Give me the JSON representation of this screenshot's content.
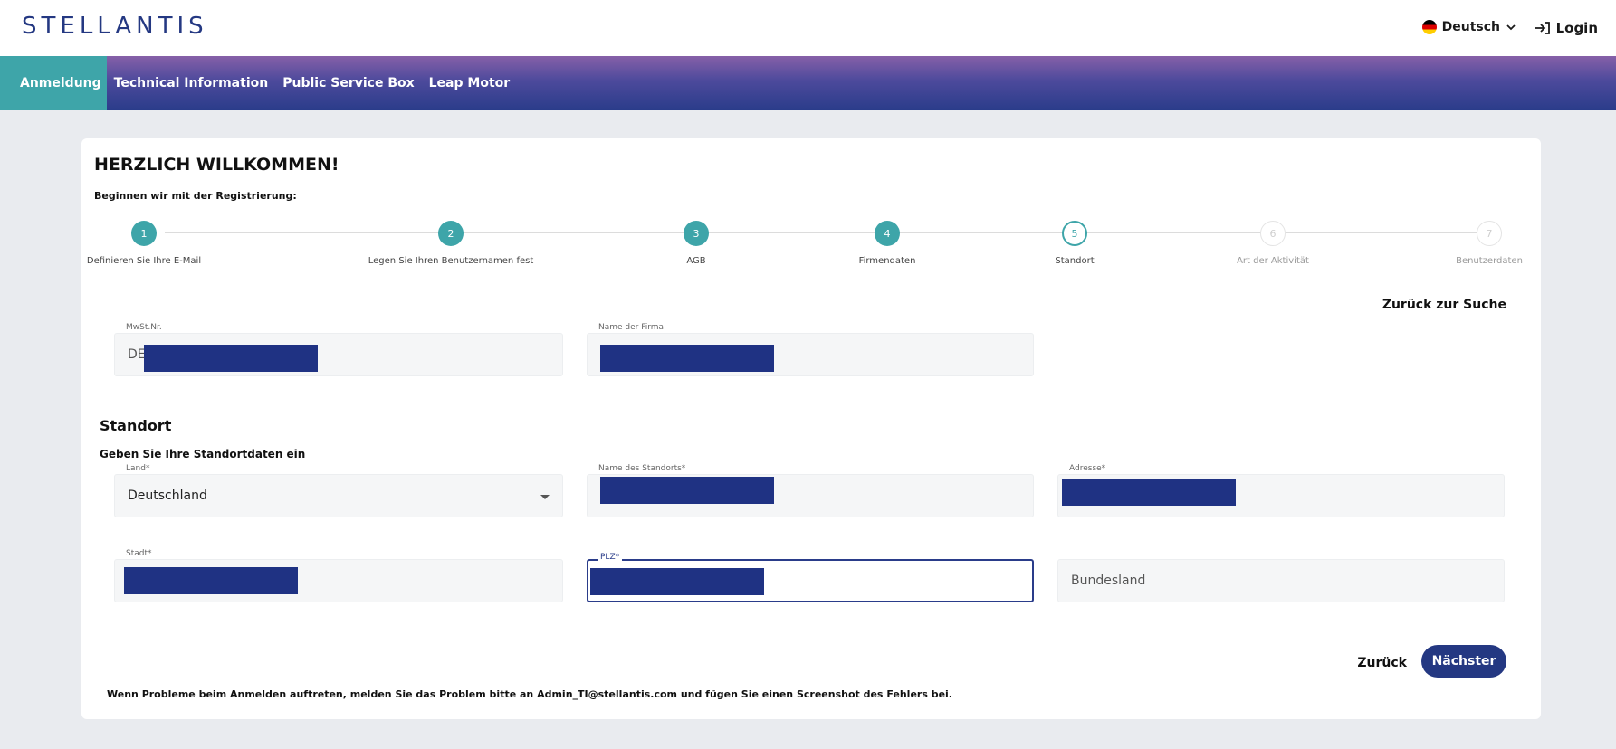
{
  "header": {
    "logo": "STELLANTIS",
    "language": "Deutsch",
    "login": "Login"
  },
  "nav": {
    "items": [
      {
        "label": "Anmeldung",
        "active": true
      },
      {
        "label": "Technical Information",
        "active": false
      },
      {
        "label": "Public Service Box",
        "active": false
      },
      {
        "label": "Leap Motor",
        "active": false
      }
    ]
  },
  "card": {
    "title": "HERZLICH WILLKOMMEN!",
    "subtitle": "Beginnen wir mit der Registrierung:",
    "back_to_search": "Zurück zur Suche"
  },
  "stepper": {
    "current_step": 5,
    "steps": [
      {
        "number": "1",
        "label": "Definieren Sie Ihre E-Mail",
        "state": "done"
      },
      {
        "number": "2",
        "label": "Legen Sie Ihren Benutzernamen fest",
        "state": "done"
      },
      {
        "number": "3",
        "label": "AGB",
        "state": "done"
      },
      {
        "number": "4",
        "label": "Firmendaten",
        "state": "done"
      },
      {
        "number": "5",
        "label": "Standort",
        "state": "current"
      },
      {
        "number": "6",
        "label": "Art der Aktivität",
        "state": "future"
      },
      {
        "number": "7",
        "label": "Benutzerdaten",
        "state": "future"
      }
    ]
  },
  "company": {
    "vat_label": "MwSt.Nr.",
    "vat_value": "DE",
    "name_label": "Name der Firma"
  },
  "location": {
    "title": "Standort",
    "subtitle": "Geben Sie Ihre Standortdaten ein",
    "country_label": "Land*",
    "country_value": "Deutschland",
    "site_name_label": "Name des Standorts*",
    "address_label": "Adresse*",
    "city_label": "Stadt*",
    "zip_label": "PLZ*",
    "state_placeholder": "Bundesland"
  },
  "actions": {
    "back": "Zurück",
    "next": "Nächster"
  },
  "footer_note": "Wenn Probleme beim Anmelden auftreten, melden Sie das Problem bitte an Admin_TI@stellantis.com und fügen Sie einen Screenshot des Fehlers bei.",
  "colors": {
    "brand_blue": "#243882",
    "accent_teal": "#3ea5a9",
    "redaction": "#1f3283"
  }
}
